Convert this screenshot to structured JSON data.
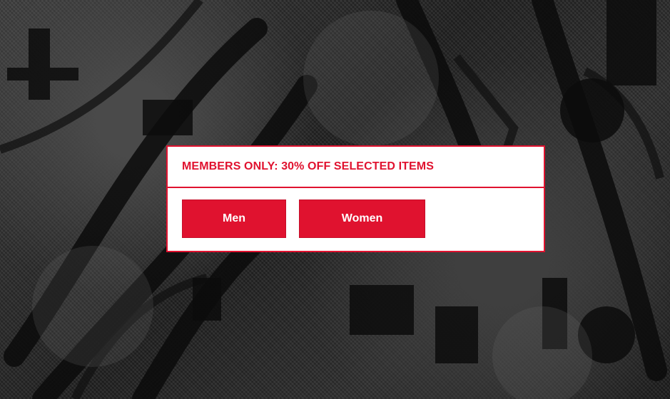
{
  "promo": {
    "title": "MEMBERS ONLY: 30% OFF SELECTED ITEMS",
    "buttons": {
      "men": "Men",
      "women": "Women"
    }
  },
  "colors": {
    "accent": "#e0122f",
    "card_background": "#ffffff",
    "hero_background": "#2b2b2b"
  },
  "hero": {
    "image_subject": "distressed-printed-fabric"
  }
}
